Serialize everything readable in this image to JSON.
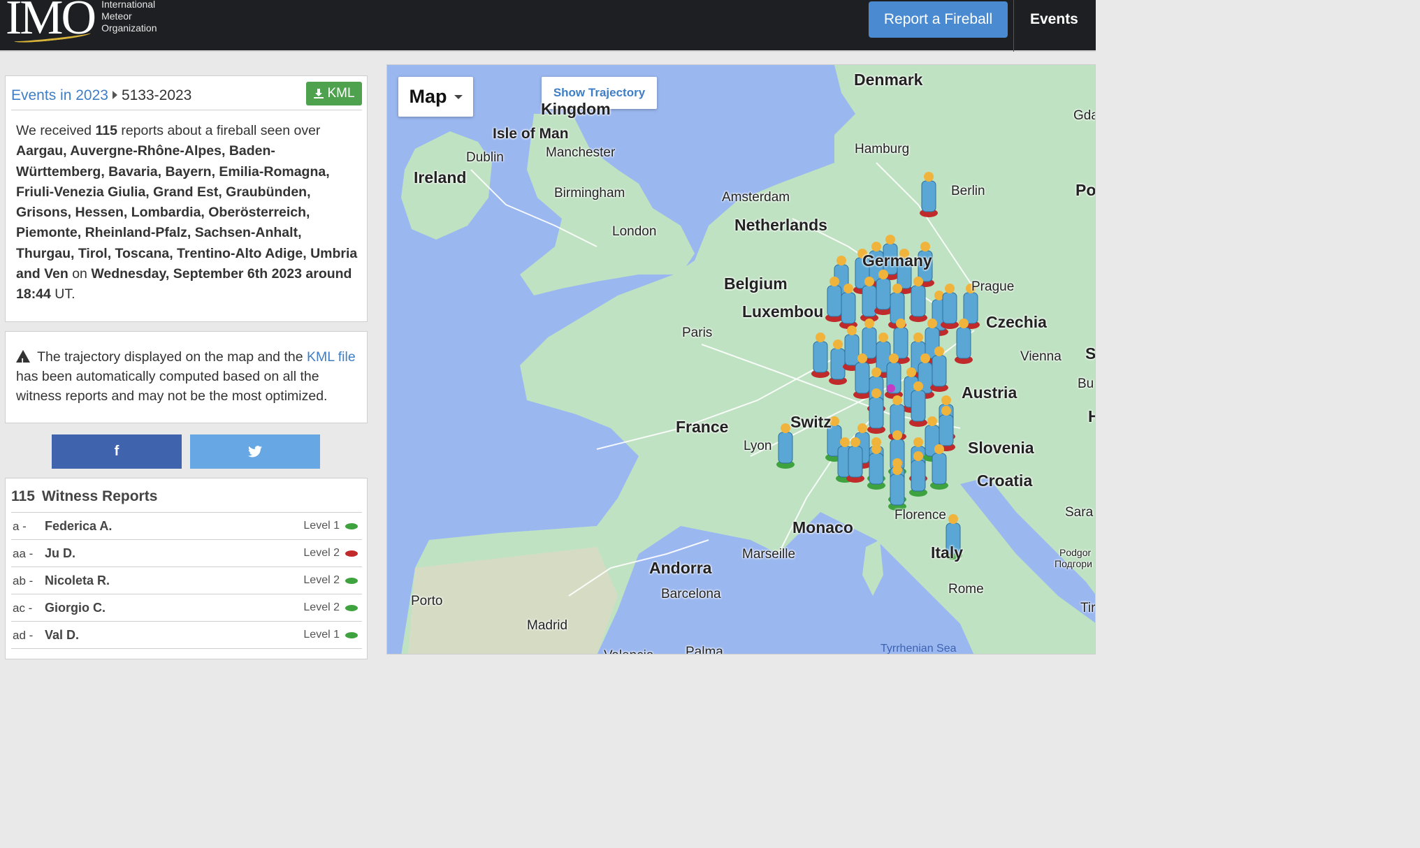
{
  "header": {
    "logo": "IMO",
    "logo_sub": [
      "International",
      "Meteor",
      "Organization"
    ],
    "report_button": "Report a Fireball",
    "events_link": "Events"
  },
  "event": {
    "breadcrumb_parent": "Events in 2023",
    "breadcrumb_current": "5133-2023",
    "kml_button": "KML",
    "desc_intro": "We received ",
    "report_count": "115",
    "desc_mid": " reports about a fireball seen over ",
    "regions": "Aargau, Auvergne-Rhône-Alpes, Baden-Württemberg, Bavaria, Bayern, Emilia-Romagna, Friuli-Venezia Giulia, Grand Est, Graubünden, Grisons, Hessen, Lombardia, Oberösterreich, Piemonte, Rheinland-Pfalz, Sachsen-Anhalt, Thurgau, Tirol, Toscana, Trentino-Alto Adige, Umbria and Ven",
    "desc_on": " on ",
    "date": "Wednesday, September 6th 2023 around 18:44",
    "desc_end": " UT."
  },
  "notice": {
    "text_before": " The trajectory displayed on the map and the ",
    "link": "KML file",
    "text_after": " has been automatically computed based on all the witness reports and may not be the most optimized."
  },
  "share": {
    "facebook": "f",
    "twitter": "twitter-icon"
  },
  "reports": {
    "count": "115",
    "title": "Witness Reports",
    "rows": [
      {
        "id": "a -",
        "name": "Federica A.",
        "level": "Level 1",
        "color": "#3ea33e"
      },
      {
        "id": "aa -",
        "name": "Ju D.",
        "level": "Level 2",
        "color": "#c12a2a"
      },
      {
        "id": "ab -",
        "name": "Nicoleta  R.",
        "level": "Level 2",
        "color": "#3ea33e"
      },
      {
        "id": "ac -",
        "name": "Giorgio  C.",
        "level": "Level 2",
        "color": "#3ea33e"
      },
      {
        "id": "ad -",
        "name": "Val D.",
        "level": "Level 1",
        "color": "#3ea33e"
      }
    ]
  },
  "map": {
    "type_button": "Map",
    "trajectory_button": "Show Trajectory",
    "labels": {
      "denmark": "Denmark",
      "kingdom": "Kingdom",
      "isle_of_man": "Isle of Man",
      "dublin": "Dublin",
      "ireland": "Ireland",
      "manchester": "Manchester",
      "birmingham": "Birmingham",
      "london": "London",
      "hamburg": "Hamburg",
      "berlin": "Berlin",
      "amsterdam": "Amsterdam",
      "netherlands": "Netherlands",
      "belgium": "Belgium",
      "luxembourg": "Luxembou",
      "germany": "Germany",
      "prague": "Prague",
      "czechia": "Czechia",
      "paris": "Paris",
      "vienna": "Vienna",
      "austria": "Austria",
      "france": "France",
      "switzerland": "Switz",
      "lyon": "Lyon",
      "slovenia": "Slovenia",
      "croatia": "Croatia",
      "monaco": "Monaco",
      "florence": "Florence",
      "marseille": "Marseille",
      "andorra": "Andorra",
      "barcelona": "Barcelona",
      "porto": "Porto",
      "madrid": "Madrid",
      "rome": "Rome",
      "italy": "Italy",
      "palma": "Palma",
      "valencia": "Valencia",
      "tyrrhenian_sea": "Tyrrhenian Sea",
      "sarajevo": "Sara",
      "podgorica": "Podgor",
      "podgorica_cyr": "Подгори",
      "gdansk": "Gda",
      "poland": "Po",
      "bratislava": "S",
      "budapest": "Bu",
      "tirana": "Tir",
      "hungary": "H"
    },
    "colors": {
      "water": "#9ab7f0",
      "land": "#bfe2c2",
      "marker": "#5aa7d6",
      "level1": "#3ea33e",
      "level2": "#c12a2a"
    }
  }
}
